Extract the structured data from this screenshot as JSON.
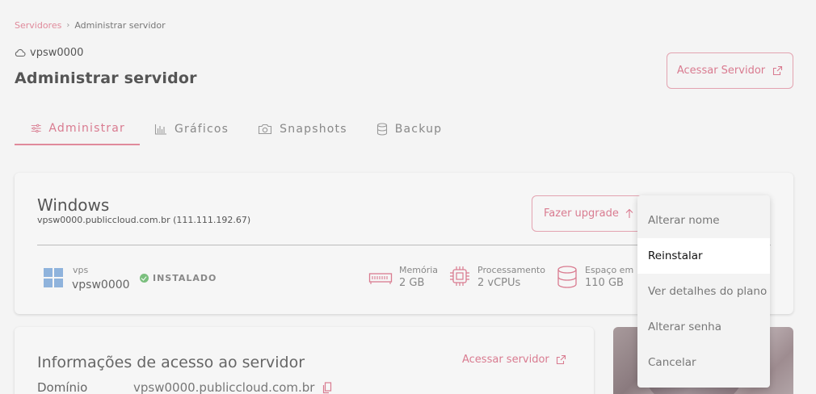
{
  "breadcrumb": {
    "parent": "Servidores",
    "current": "Administrar servidor"
  },
  "server": {
    "id": "vpsw0000"
  },
  "page": {
    "title": "Administrar servidor"
  },
  "header": {
    "access_button": "Acessar Servidor"
  },
  "tabs": [
    {
      "label": "Administrar",
      "icon": "sliders-icon",
      "active": true
    },
    {
      "label": "Gráficos",
      "icon": "bar-chart-icon",
      "active": false
    },
    {
      "label": "Snapshots",
      "icon": "camera-icon",
      "active": false
    },
    {
      "label": "Backup",
      "icon": "database-icon",
      "active": false
    }
  ],
  "main_card": {
    "os_name": "Windows",
    "host": "vpsw0000.publiccloud.com.br (111.111.192.67)",
    "upgrade_button": "Fazer upgrade",
    "vps_label": "vps",
    "vps_value": "vpsw0000",
    "status": "INSTALADO",
    "specs": [
      {
        "label": "Memória",
        "value": "2 GB",
        "icon": "memory-icon"
      },
      {
        "label": "Processamento",
        "value": "2 vCPUs",
        "icon": "cpu-icon"
      },
      {
        "label": "Espaço em",
        "value": "110 GB",
        "icon": "storage-icon"
      }
    ]
  },
  "info_card": {
    "title": "Informações de acesso ao servidor",
    "access_link": "Acessar servidor",
    "domain_label": "Domínio",
    "domain_value": "vpsw0000.publiccloud.com.br"
  },
  "context_menu": {
    "items": [
      "Alterar nome",
      "Reinstalar",
      "Ver detalhes do plano",
      "Alterar senha",
      "Cancelar"
    ],
    "highlighted": "Reinstalar"
  },
  "colors": {
    "accent": "#d97b90",
    "background": "#f4f4f4",
    "status_ok": "#7bbf7e",
    "windows_blue": "#8fb3dc"
  }
}
